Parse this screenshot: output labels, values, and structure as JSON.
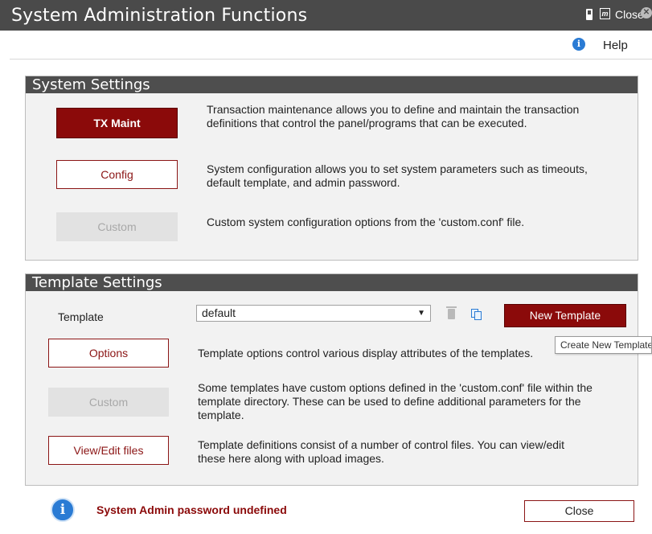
{
  "window": {
    "title": "System Administration Functions",
    "close_label": "Close",
    "close_glyph": "✕",
    "doc_glyph": "m"
  },
  "toolbar": {
    "info_glyph": "i",
    "help_label": "Help"
  },
  "system_settings": {
    "heading": "System Settings",
    "items": [
      {
        "button": "TX Maint",
        "state": "active",
        "description": "Transaction maintenance allows you to define and maintain the transaction definitions that control the panel/programs that can be executed."
      },
      {
        "button": "Config",
        "state": "normal",
        "description": "System configuration allows you to set system parameters such as timeouts, default template, and admin password."
      },
      {
        "button": "Custom",
        "state": "disabled",
        "description": "Custom system configuration options from the 'custom.conf' file."
      }
    ]
  },
  "template_settings": {
    "heading": "Template Settings",
    "template_label": "Template",
    "template_value": "default",
    "dropdown_arrow": "▼",
    "new_template_label": "New Template",
    "tooltip": "Create New Template",
    "items": [
      {
        "button": "Options",
        "state": "normal",
        "description": "Template options control various display attributes of the templates."
      },
      {
        "button": "Custom",
        "state": "disabled",
        "description": "Some templates have custom options defined in the 'custom.conf' file within the template directory. These can be used to define additional parameters for the template."
      },
      {
        "button": "View/Edit files",
        "state": "normal",
        "description": "Template definitions consist of a number of control files. You can view/edit these here along with upload images."
      }
    ]
  },
  "footer": {
    "info_glyph": "i",
    "message": "System Admin password undefined",
    "close_label": "Close"
  },
  "colors": {
    "accent": "#8b0a0a",
    "header_bg": "#4a4a4a",
    "info_blue": "#2a7bd4"
  }
}
